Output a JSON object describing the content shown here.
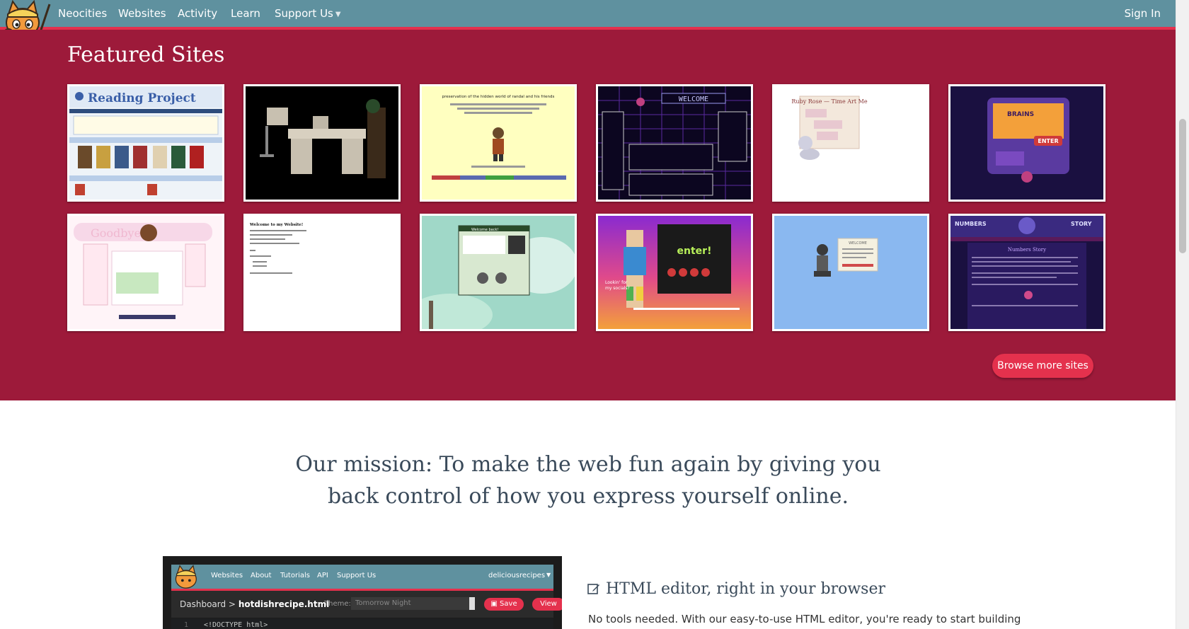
{
  "nav": {
    "brand": "Neocities",
    "items": [
      "Websites",
      "Activity",
      "Learn"
    ],
    "support": "Support Us",
    "sign_in": "Sign In"
  },
  "featured": {
    "title": "Featured Sites",
    "browse_button": "Browse more sites",
    "sites": [
      {
        "label": "Reading Project"
      },
      {
        "label": ""
      },
      {
        "label": "preservation of the hidden world of randal and his friends"
      },
      {
        "label": "WELCOME"
      },
      {
        "label": "Ruby Rose — Time Art Me"
      },
      {
        "label": "BRAINS — ENTER"
      },
      {
        "label": "Goodbye"
      },
      {
        "label": "Welcome to my Website!"
      },
      {
        "label": "Welcome back!"
      },
      {
        "label": "enter!"
      },
      {
        "label": "WELCOME"
      },
      {
        "label": "Numbers Story"
      }
    ]
  },
  "mission": {
    "line1": "Our mission: To make the web fun again by giving you",
    "line2": "back control of how you express yourself online."
  },
  "editor_preview": {
    "nav_items": [
      "Websites",
      "About",
      "Tutorials",
      "API",
      "Support Us"
    ],
    "account": "deliciousrecipes",
    "path_prefix": "Dashboard >",
    "file_name": "hotdishrecipe.html",
    "theme_label": "Theme:",
    "theme_value": "Tomorrow Night",
    "save_label": "Save",
    "view_label": "View",
    "code_line_number": "1",
    "code_line": "<!DOCTYPE html>"
  },
  "feature": {
    "title": "HTML editor, right in your browser",
    "description": "No tools needed. With our easy-to-use HTML editor, you're ready to start building"
  },
  "colors": {
    "nav_bg": "#5f919f",
    "accent": "#e4314d",
    "featured_bg": "#9d1a3a"
  }
}
